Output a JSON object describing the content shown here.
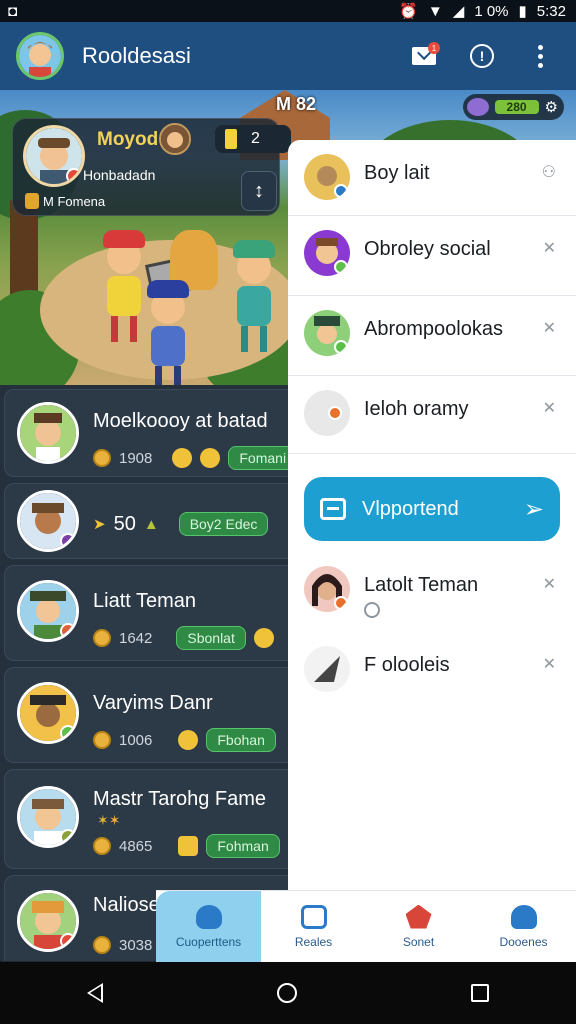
{
  "status_bar": {
    "left_icon": "notification-icon",
    "battery": "1 0%",
    "time": "5:32"
  },
  "app_bar": {
    "title": "Rooldesasi",
    "notif_count": "1"
  },
  "scene": {
    "hut_label": "M 82",
    "currency_bar": "280",
    "player_card": {
      "name": "Moyod",
      "level_num": "2",
      "subtitle": "Honbadadn",
      "tag": "M Fomena"
    }
  },
  "friends": [
    {
      "name": "Moelkoooy at batad",
      "score": "1908",
      "pill": "Fomani"
    },
    {
      "name": "",
      "score": "50",
      "pill": "Boy2 Edec"
    },
    {
      "name": "Liatt Teman",
      "score": "1642",
      "pill": "Sbonlat"
    },
    {
      "name": "Varyims Danr",
      "score": "1006",
      "pill": "Fbohan"
    },
    {
      "name": "Mastr Tarohg Fame",
      "score": "4865",
      "pill": "Fohman"
    },
    {
      "name": "Naliose",
      "score": "3038",
      "pill": ""
    }
  ],
  "panel": {
    "rows": [
      {
        "label": "Boy lait"
      },
      {
        "label": "Obroley social"
      },
      {
        "label": "Abrompoolokas"
      },
      {
        "label": "Ieloh oramy"
      }
    ],
    "send_label": "Vlpportend",
    "rows2": [
      {
        "label": "Latolt Teman"
      },
      {
        "label": "F olooleis"
      }
    ]
  },
  "bottom_nav": [
    {
      "label": "Cuoperttens"
    },
    {
      "label": "Reales"
    },
    {
      "label": "Sonet"
    },
    {
      "label": "Dooenes"
    }
  ],
  "colors": {
    "appbar": "#1f4f80",
    "accent": "#1e9fd1",
    "online": "#6bc76a",
    "pill_green": "#2e8a44"
  }
}
